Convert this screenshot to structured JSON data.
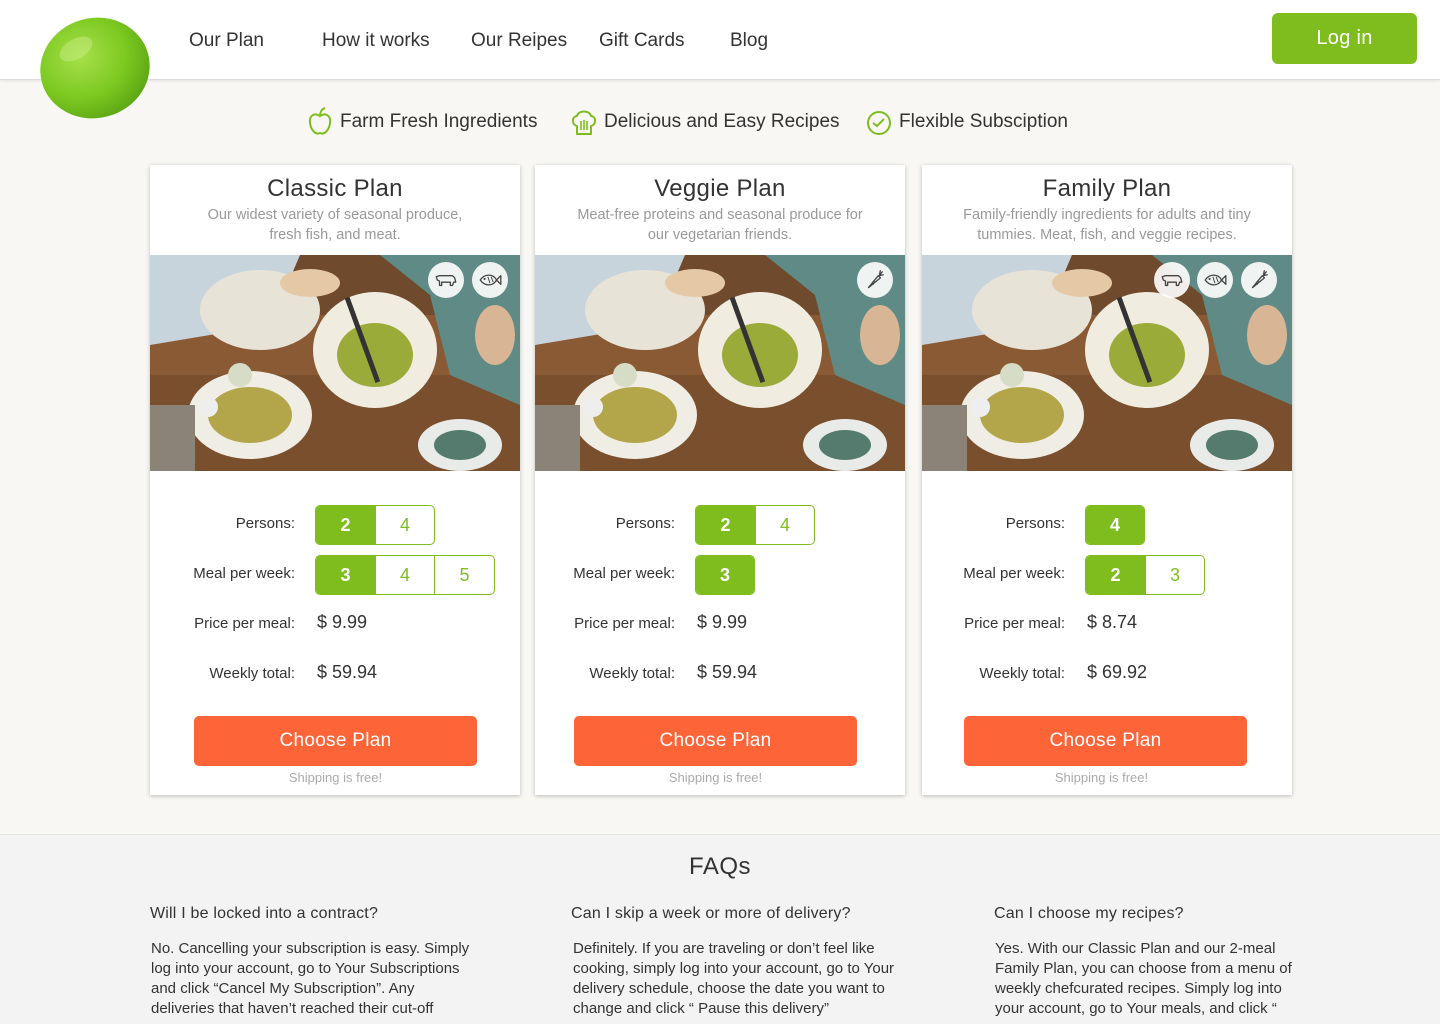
{
  "nav": {
    "items": [
      "Our Plan",
      "How it works",
      "Our Reipes",
      "Gift Cards",
      "Blog"
    ],
    "login_label": "Log in"
  },
  "features": [
    {
      "label": "Farm Fresh Ingredients",
      "icon": "apple-icon"
    },
    {
      "label": "Delicious and Easy Recipes",
      "icon": "chef-hat-icon"
    },
    {
      "label": "Flexible Subsciption",
      "icon": "clock-icon"
    }
  ],
  "labels": {
    "persons": "Persons:",
    "meals": "Meal per week:",
    "price": "Price per meal:",
    "total": "Weekly total:"
  },
  "plans": [
    {
      "title": "Classic Plan",
      "desc": "Our widest variety of seasonal produce, fresh fish, and meat.",
      "badges": [
        "cow-icon",
        "fish-icon"
      ],
      "persons": [
        "2",
        "4"
      ],
      "persons_selected": "2",
      "meals": [
        "3",
        "4",
        "5"
      ],
      "meals_selected": "3",
      "price": "$ 9.99",
      "total": "$ 59.94",
      "button": "Choose Plan",
      "shipping": "Shipping is free!"
    },
    {
      "title": "Veggie Plan",
      "desc": "Meat-free proteins and seasonal produce for our vegetarian friends.",
      "badges": [
        "carrot-icon"
      ],
      "persons": [
        "2",
        "4"
      ],
      "persons_selected": "2",
      "meals": [
        "3"
      ],
      "meals_selected": "3",
      "price": "$ 9.99",
      "total": "$ 59.94",
      "button": "Choose Plan",
      "shipping": "Shipping is free!"
    },
    {
      "title": "Family Plan",
      "desc": "Family-friendly ingredients for adults and tiny tummies. Meat, fish, and veggie recipes.",
      "badges": [
        "cow-icon",
        "fish-icon",
        "carrot-icon"
      ],
      "persons": [
        "4"
      ],
      "persons_selected": "4",
      "meals": [
        "2",
        "3"
      ],
      "meals_selected": "2",
      "price": "$ 8.74",
      "total": "$ 69.92",
      "button": "Choose Plan",
      "shipping": "Shipping is free!"
    }
  ],
  "faq": {
    "title": "FAQs",
    "items": [
      {
        "q": "Will I be locked into a contract?",
        "a": "No. Cancelling your subscription is easy. Simply log into your account, go to Your Subscriptions and click “Cancel My Subscription”. Any deliveries that haven’t reached their cut-off"
      },
      {
        "q": "Can I skip a week or more of delivery?",
        "a": "Definitely. If you are traveling or don’t feel like cooking, simply log into your account, go to Your delivery schedule, choose the date you want to change and click “ Pause this delivery”"
      },
      {
        "q": "Can I choose my recipes?",
        "a": "Yes. With our Classic Plan and our 2-meal Family Plan, you can choose from a menu of weekly chefcurated recipes. Simply log into your account, go to Your meals, and click “"
      }
    ]
  },
  "colors": {
    "accent_green": "#7fbd1f",
    "cta_orange": "#fd6538"
  }
}
